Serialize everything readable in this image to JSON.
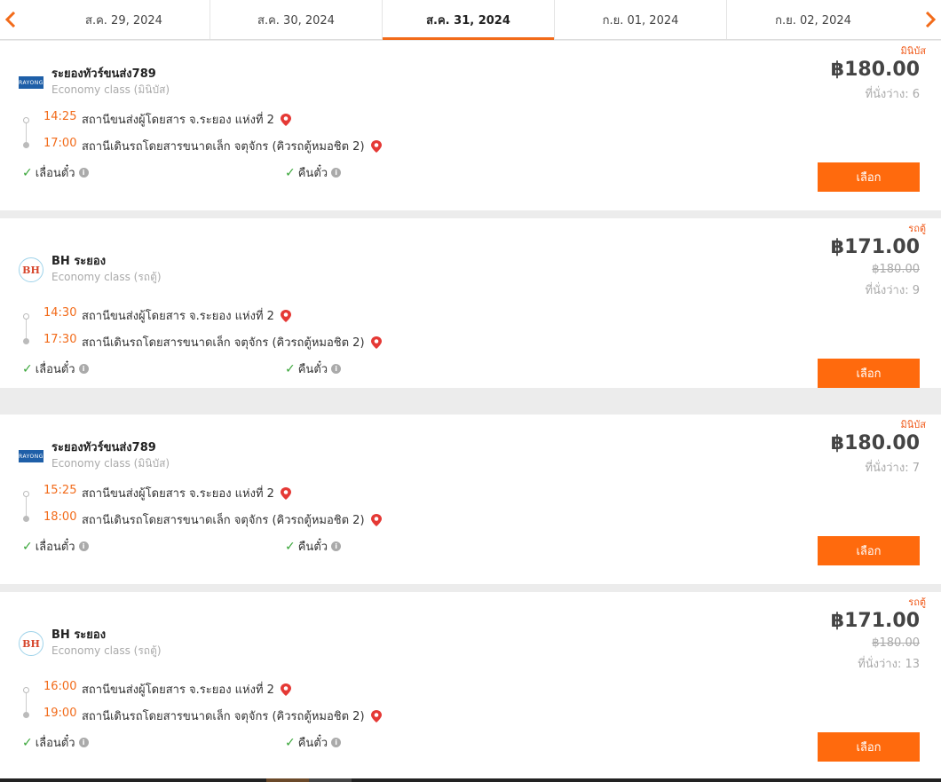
{
  "nav": {
    "dates": [
      "ส.ค. 29, 2024",
      "ส.ค. 30, 2024",
      "ส.ค. 31, 2024",
      "ก.ย. 01, 2024",
      "ก.ย. 02, 2024"
    ],
    "active_index": 2,
    "accent_color": "#f26b1a"
  },
  "trips": [
    {
      "tag": "มินิบัส",
      "logo_icon": "rayong-tour-logo",
      "company": "ระยองทัวร์ขนส่ง789",
      "class": "Economy class (มินิบัส)",
      "depart_time": "14:25",
      "depart_station": "สถานีขนส่งผู้โดยสาร จ.ระยอง แห่งที่ 2",
      "arrive_time": "17:00",
      "arrive_station": "สถานีเดินรถโดยสารขนาดเล็ก จตุจักร (คิวรถตู้หมอชิต 2)",
      "feature_change": "เลื่อนตั๋ว",
      "feature_refund": "คืนตั๋ว",
      "price": "฿180.00",
      "old_price": "",
      "seats": "ที่นั่งว่าง: 6",
      "button": "เลือก"
    },
    {
      "tag": "รถตู้",
      "logo_icon": "bh-logo",
      "logo_text": "BH",
      "company": "BH ระยอง",
      "class": "Economy class (รถตู้)",
      "depart_time": "14:30",
      "depart_station": "สถานีขนส่งผู้โดยสาร จ.ระยอง แห่งที่ 2",
      "arrive_time": "17:30",
      "arrive_station": "สถานีเดินรถโดยสารขนาดเล็ก จตุจักร (คิวรถตู้หมอชิต 2)",
      "feature_change": "เลื่อนตั๋ว",
      "feature_refund": "คืนตั๋ว",
      "price": "฿171.00",
      "old_price": "฿180.00",
      "seats": "ที่นั่งว่าง: 9",
      "button": "เลือก"
    },
    {
      "tag": "มินิบัส",
      "logo_icon": "rayong-tour-logo",
      "company": "ระยองทัวร์ขนส่ง789",
      "class": "Economy class (มินิบัส)",
      "depart_time": "15:25",
      "depart_station": "สถานีขนส่งผู้โดยสาร จ.ระยอง แห่งที่ 2",
      "arrive_time": "18:00",
      "arrive_station": "สถานีเดินรถโดยสารขนาดเล็ก จตุจักร (คิวรถตู้หมอชิต 2)",
      "feature_change": "เลื่อนตั๋ว",
      "feature_refund": "คืนตั๋ว",
      "price": "฿180.00",
      "old_price": "",
      "seats": "ที่นั่งว่าง: 7",
      "button": "เลือก"
    },
    {
      "tag": "รถตู้",
      "logo_icon": "bh-logo",
      "logo_text": "BH",
      "company": "BH ระยอง",
      "class": "Economy class (รถตู้)",
      "depart_time": "16:00",
      "depart_station": "สถานีขนส่งผู้โดยสาร จ.ระยอง แห่งที่ 2",
      "arrive_time": "19:00",
      "arrive_station": "สถานีเดินรถโดยสารขนาดเล็ก จตุจักร (คิวรถตู้หมอชิต 2)",
      "feature_change": "เลื่อนตั๋ว",
      "feature_refund": "คืนตั๋ว",
      "price": "฿171.00",
      "old_price": "฿180.00",
      "seats": "ที่นั่งว่าง: 13",
      "button": "เลือก"
    }
  ],
  "colors": {
    "button": "#ff6a0d",
    "time": "#f26b1a",
    "tag": "#f05a1a",
    "check": "#3aa63a",
    "pin": "#e53935"
  }
}
